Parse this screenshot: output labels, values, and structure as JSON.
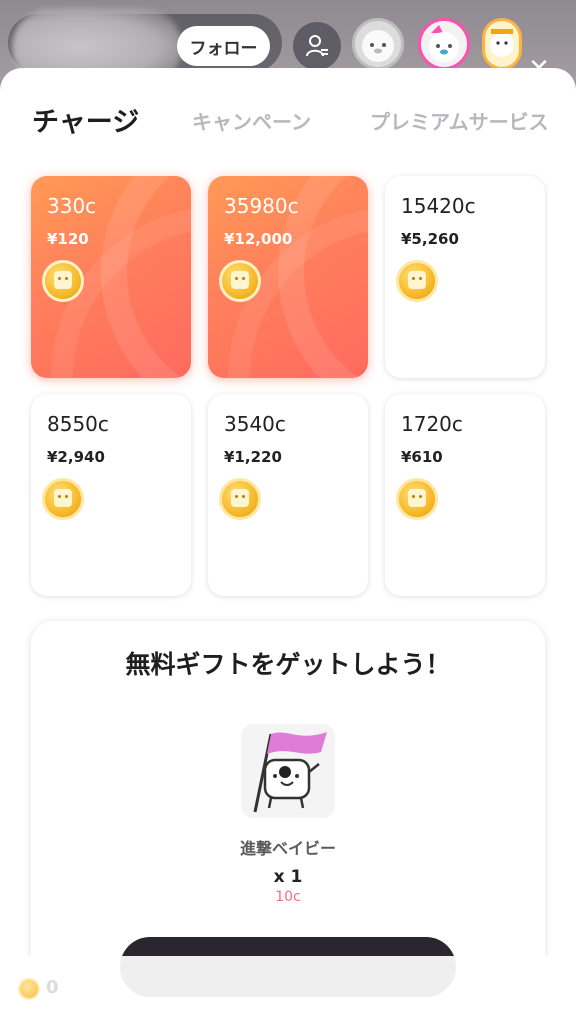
{
  "header": {
    "follow_label": "フォロー",
    "viewer_list_icon": "person-list-icon",
    "close_icon": "close-icon"
  },
  "tabs": [
    {
      "label": "チャージ",
      "active": true
    },
    {
      "label": "キャンペーン",
      "active": false
    },
    {
      "label": "プレミアムサービス",
      "active": false
    }
  ],
  "packages": [
    {
      "coins": "330c",
      "price": "¥120",
      "highlighted": true
    },
    {
      "coins": "35980c",
      "price": "¥12,000",
      "highlighted": true
    },
    {
      "coins": "15420c",
      "price": "¥5,260",
      "highlighted": false
    },
    {
      "coins": "8550c",
      "price": "¥2,940",
      "highlighted": false
    },
    {
      "coins": "3540c",
      "price": "¥1,220",
      "highlighted": false
    },
    {
      "coins": "1720c",
      "price": "¥610",
      "highlighted": false
    }
  ],
  "free_gift": {
    "title": "無料ギフトをゲットしよう！",
    "gift_name": "進撃ベイビー",
    "quantity": "x 1",
    "cost": "10c"
  },
  "balance": {
    "icon": "coin-icon",
    "value": "0"
  },
  "colors": {
    "accent_gradient_start": "#ff9a55",
    "accent_gradient_end": "#ff6a5e",
    "cost_red": "#ff6b7a",
    "button_dark": "#2a2630"
  }
}
